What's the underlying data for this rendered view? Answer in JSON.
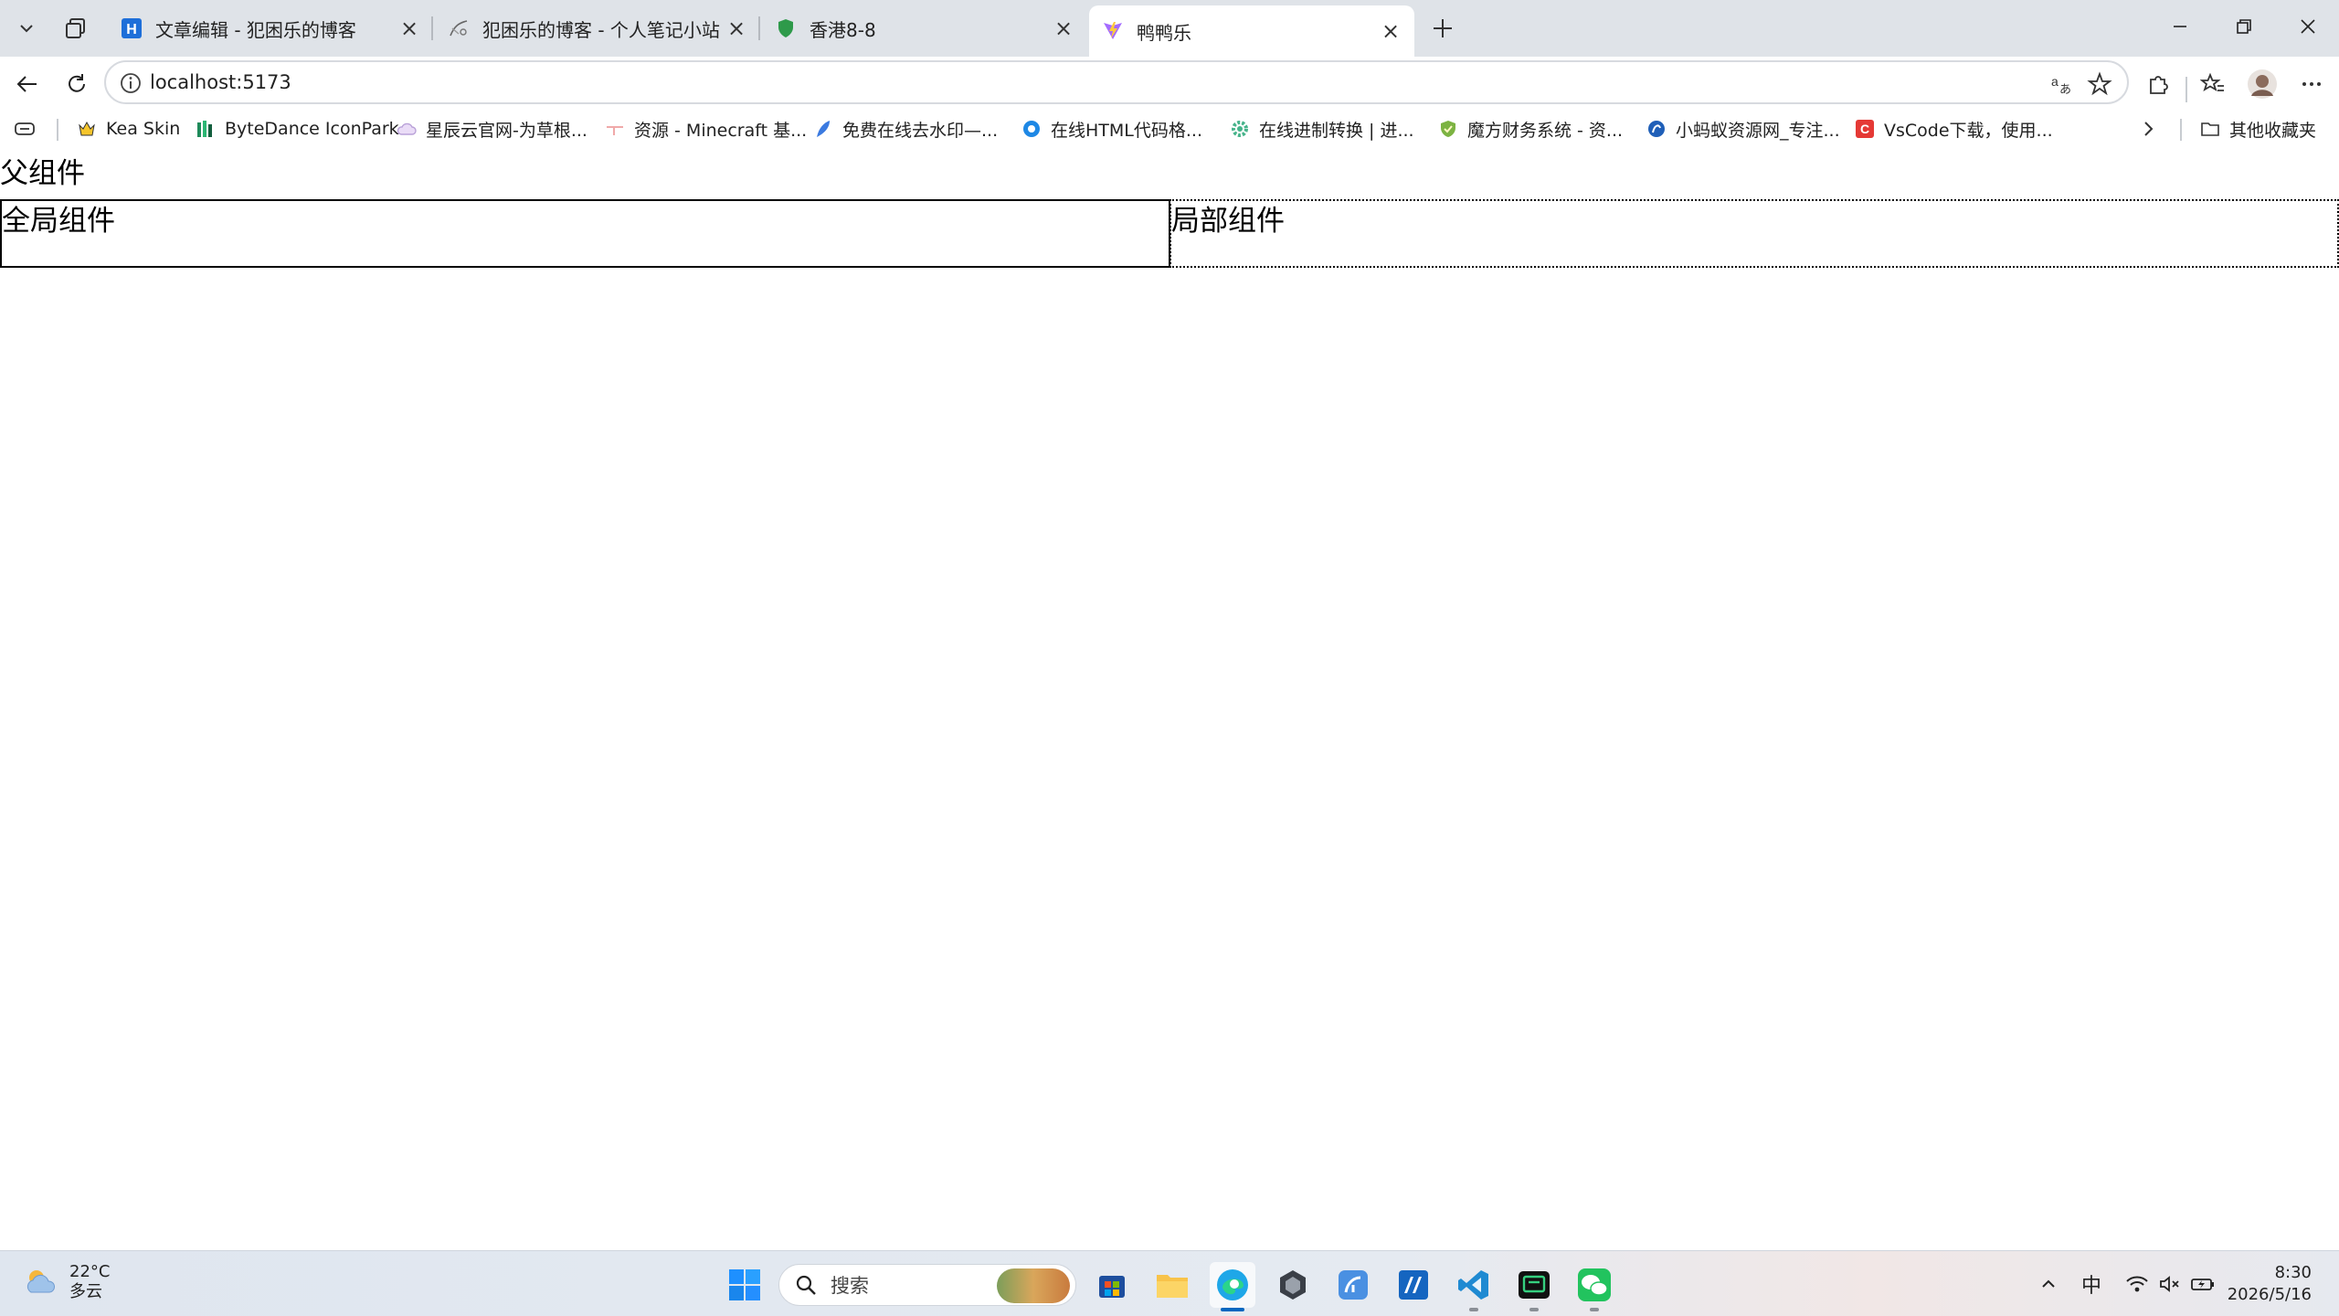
{
  "browser": {
    "tabs": [
      {
        "title": "文章编辑 - 犯困乐的博客",
        "favicon": "h-logo-icon"
      },
      {
        "title": "犯困乐的博客 - 个人笔记小站",
        "favicon": "sketch-icon"
      },
      {
        "title": "香港8-8",
        "favicon": "shield-icon"
      },
      {
        "title": "鸭鸭乐",
        "favicon": "vite-icon",
        "active": true
      }
    ],
    "url": "localhost:5173",
    "accent": "#0067c0"
  },
  "bookmarks": {
    "items": [
      {
        "label": "Kea Skin"
      },
      {
        "label": "ByteDance IconPark"
      },
      {
        "label": "星辰云官网-为草根..."
      },
      {
        "label": "资源 - Minecraft 基..."
      },
      {
        "label": "免费在线去水印—..."
      },
      {
        "label": "在线HTML代码格..."
      },
      {
        "label": "在线进制转换 | 进..."
      },
      {
        "label": "魔方财务系统 - 资..."
      },
      {
        "label": "小蚂蚁资源网_专注..."
      },
      {
        "label": "VsCode下载，使用..."
      }
    ],
    "other_folder": "其他收藏夹"
  },
  "page": {
    "parent_title": "父组件",
    "global_component": "全局组件",
    "local_component": "局部组件"
  },
  "taskbar": {
    "weather_temp": "22°C",
    "weather_desc": "多云",
    "search_placeholder": "搜索",
    "ime": "中",
    "time": "8:30",
    "date": "2026/5/16"
  }
}
